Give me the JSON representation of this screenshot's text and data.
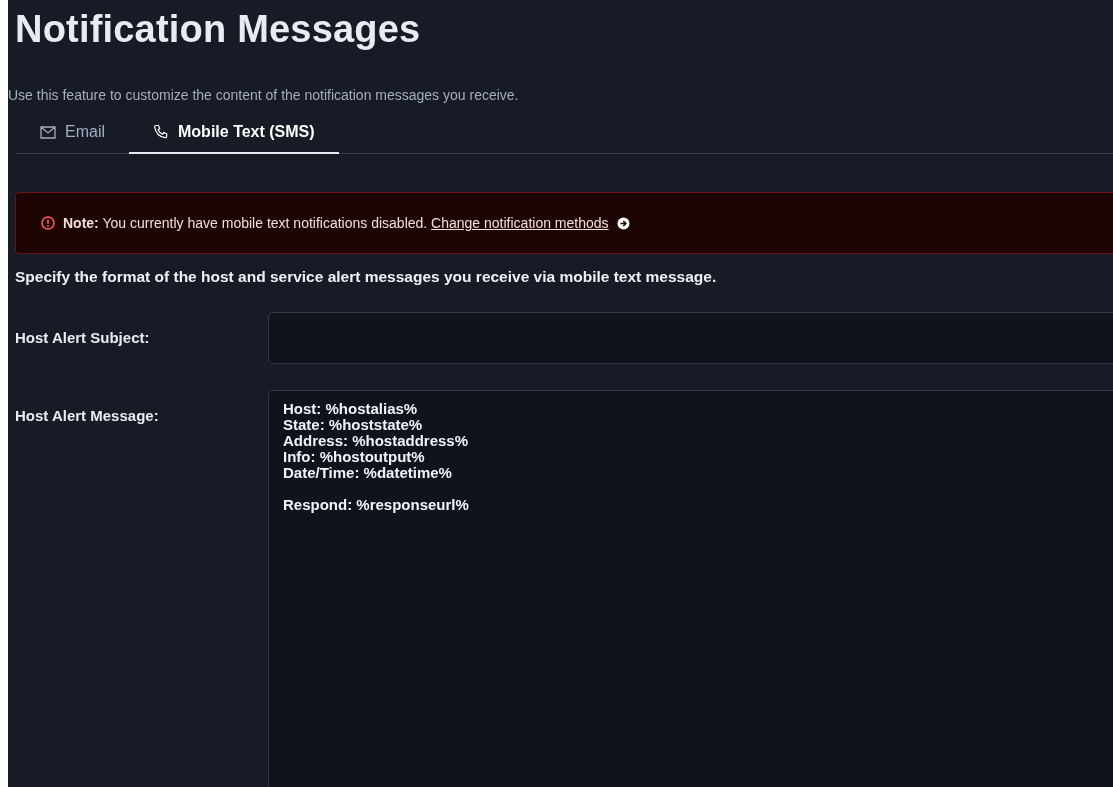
{
  "title": "Notification Messages",
  "subtitle": "Use this feature to customize the content of the notification messages you receive.",
  "tabs": [
    {
      "label": "Email",
      "kind": "mail",
      "selected": false
    },
    {
      "label": "Mobile Text (SMS)",
      "kind": "phone",
      "selected": true
    }
  ],
  "alert": {
    "text": "**Note:** You currently have mobile text notifications disabled.",
    "link": "Change notification methods"
  },
  "description": "Specify the format of the host and service alert messages you receive via mobile text message.",
  "fields": [
    {
      "label": "Host Alert Subject:",
      "kind": "input"
    },
    {
      "label": "Host Alert Message:",
      "kind": "textarea",
      "value": "Host: %hostalias%\nState: %hoststate%\nAddress: %hostaddress%\nInfo: %hostoutput%\nDate/Time: %datetime%\n\nRespond: %responseurl%"
    }
  ]
}
